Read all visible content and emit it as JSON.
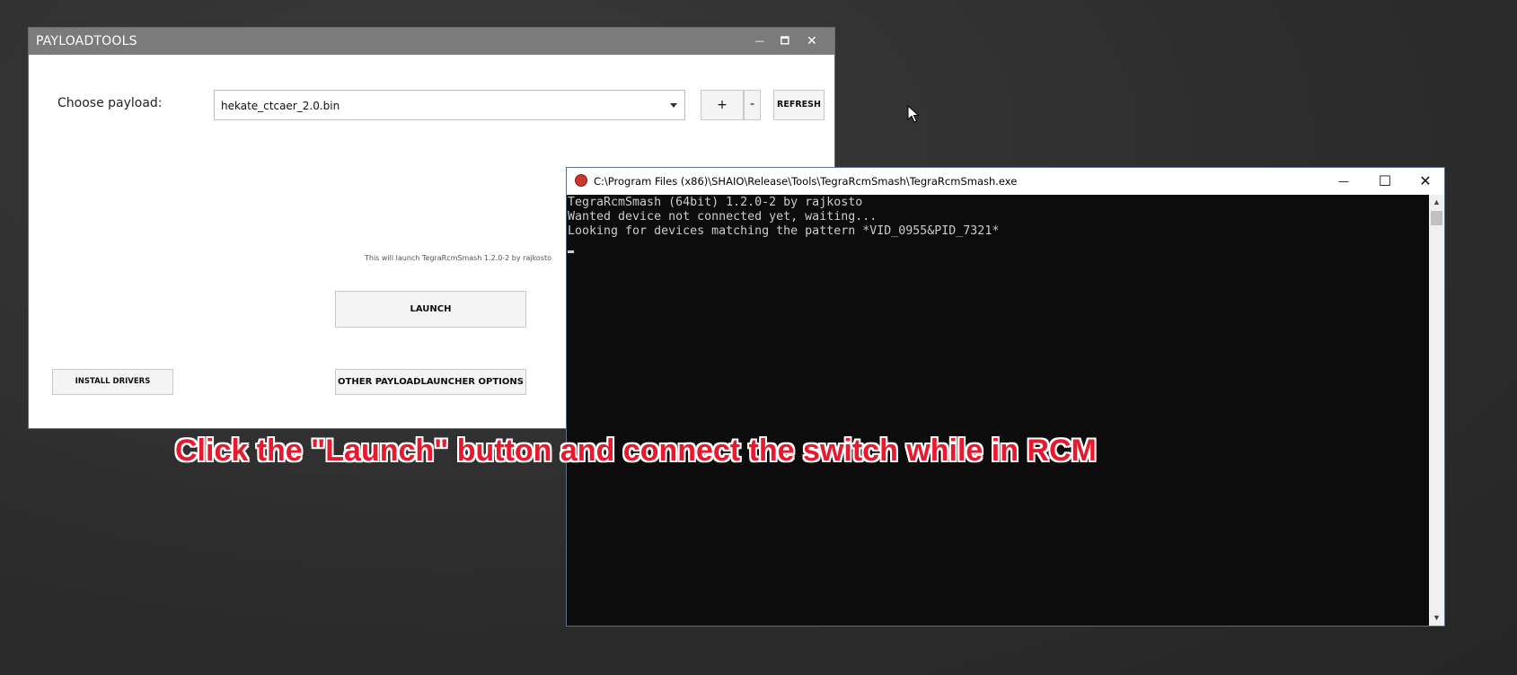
{
  "payloadtools": {
    "title": "PAYLOADTOOLS",
    "controls": {
      "minimize": "—",
      "maximize": "🗖",
      "close": "✕"
    },
    "choose_label": "Choose payload:",
    "payload_selected": "hekate_ctcaer_2.0.bin",
    "plus_label": "+",
    "minus_label": "-",
    "refresh_label": "REFRESH",
    "launch_note": "This will launch TegraRcmSmash 1.2.0-2 by rajkosto",
    "launch_label": "LAUNCH",
    "install_drivers_label": "INSTALL DRIVERS",
    "other_options_label": "OTHER PAYLOADLAUNCHER OPTIONS"
  },
  "console": {
    "title": "C:\\Program Files (x86)\\SHAIO\\Release\\Tools\\TegraRcmSmash\\TegraRcmSmash.exe",
    "controls": {
      "minimize": "—",
      "maximize": "☐",
      "close": "✕"
    },
    "lines": [
      "TegraRcmSmash (64bit) 1.2.0-2 by rajkosto",
      "Wanted device not connected yet, waiting...",
      "Looking for devices matching the pattern *VID_0955&PID_7321*"
    ],
    "scroll_up": "▲",
    "scroll_down": "▼"
  },
  "caption": "Click the \"Launch\" button and connect the switch while in RCM",
  "colors": {
    "caption": "#e8192c",
    "titlebar": "#7b7b7b",
    "console_bg": "#0c0c0c"
  }
}
